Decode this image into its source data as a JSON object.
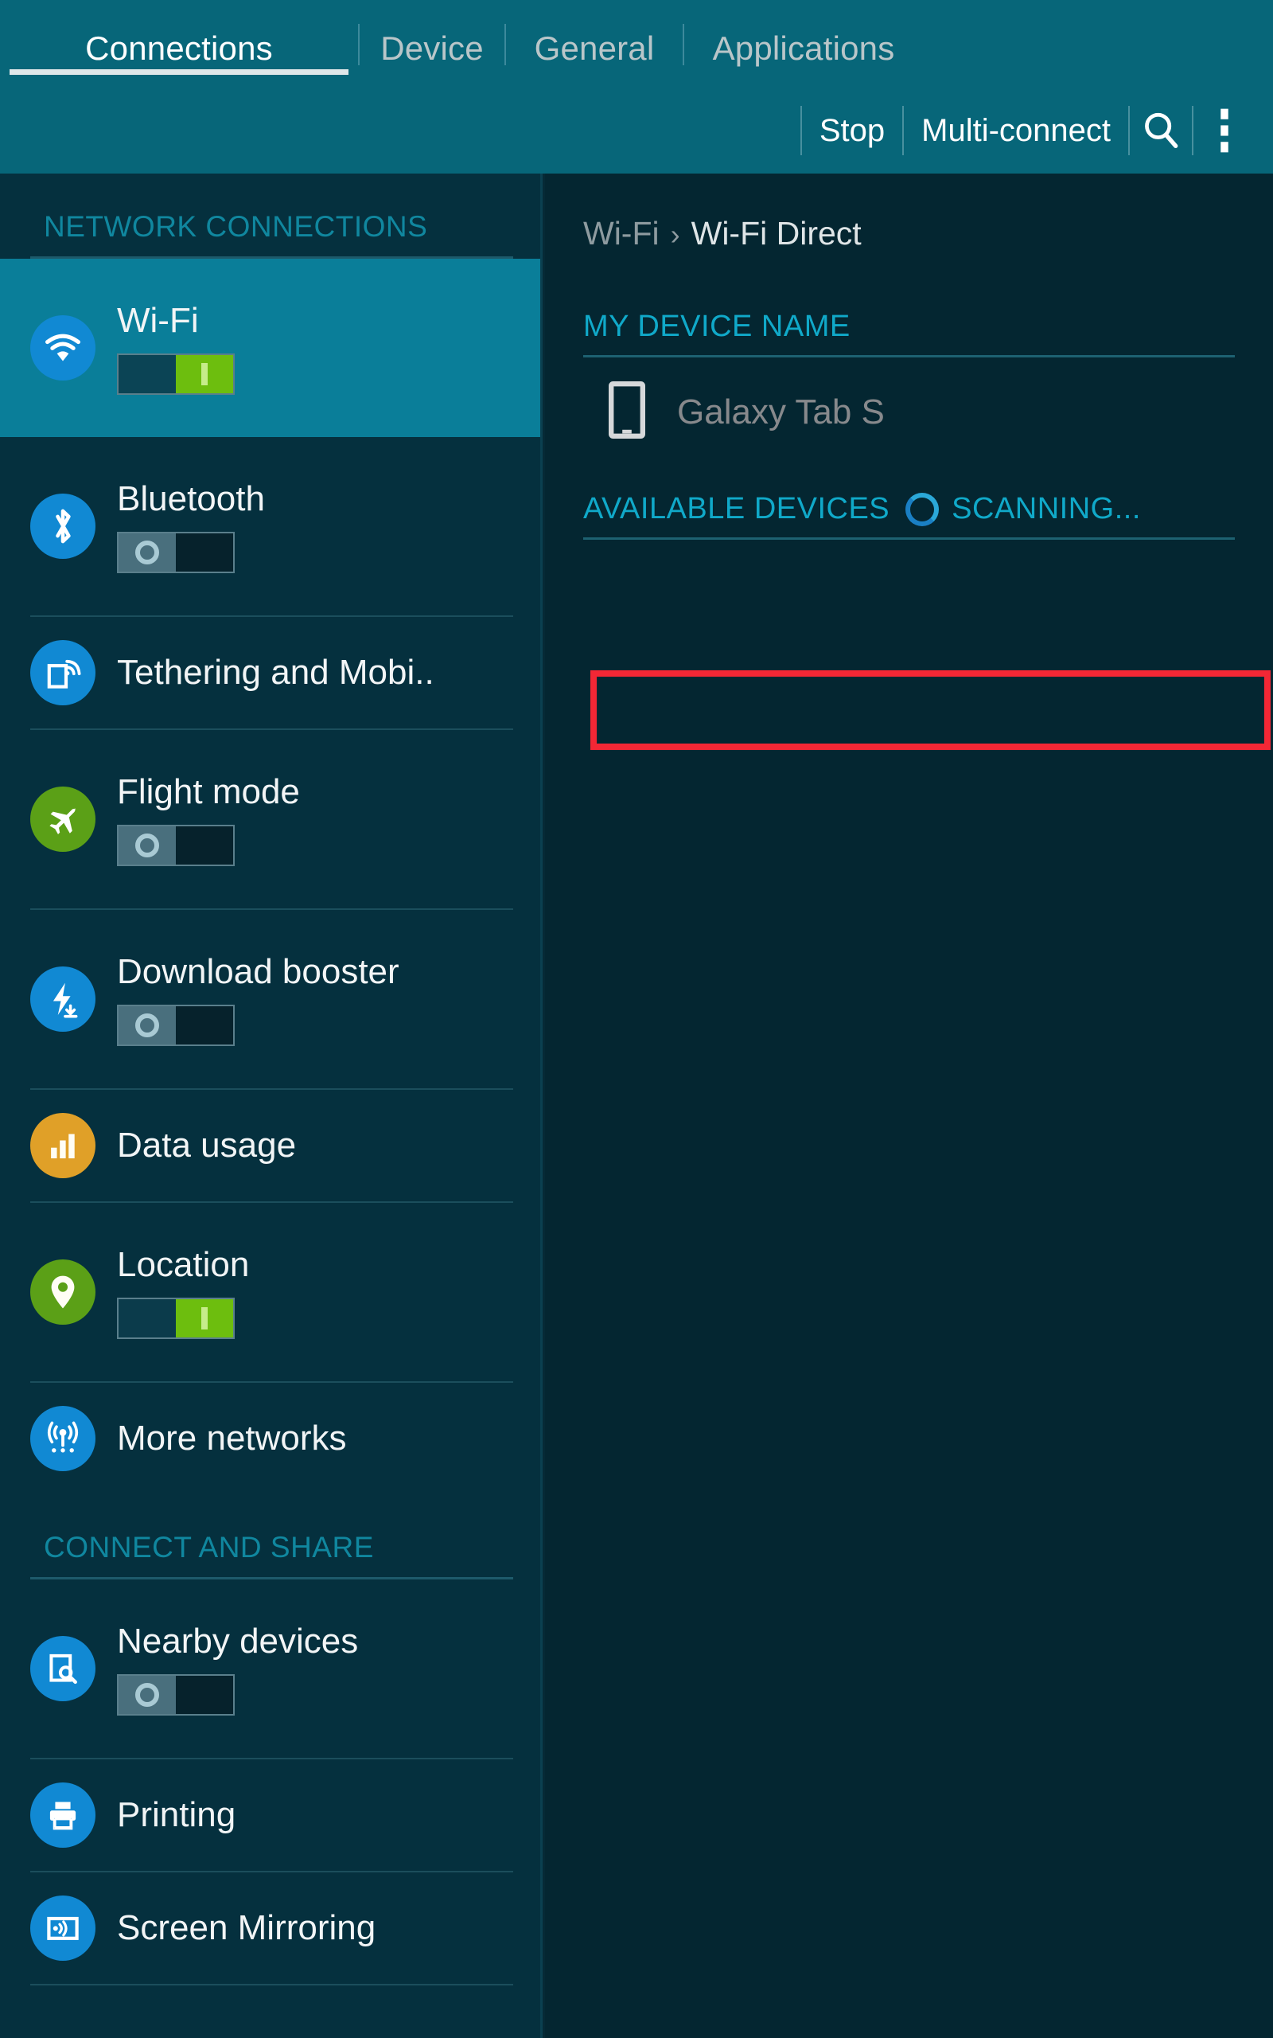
{
  "topbar": {
    "tabs": [
      {
        "label": "Connections",
        "active": true
      },
      {
        "label": "Device",
        "active": false
      },
      {
        "label": "General",
        "active": false
      },
      {
        "label": "Applications",
        "active": false
      }
    ],
    "actions": {
      "stop_label": "Stop",
      "multiconnect_label": "Multi-connect",
      "search_icon": "search-icon",
      "overflow_icon": "more-vertical-icon"
    }
  },
  "sidebar": {
    "sections": [
      {
        "title": "NETWORK CONNECTIONS",
        "items": [
          {
            "label": "Wi-Fi",
            "icon": "wifi-icon",
            "icon_color": "#1189d3",
            "selected": true,
            "toggle": "on"
          },
          {
            "label": "Bluetooth",
            "icon": "bluetooth-icon",
            "icon_color": "#1189d3",
            "selected": false,
            "toggle": "off"
          },
          {
            "label": "Tethering and Mobi..",
            "icon": "tethering-icon",
            "icon_color": "#1189d3",
            "selected": false,
            "toggle": "none"
          },
          {
            "label": "Flight mode",
            "icon": "airplane-icon",
            "icon_color": "#5ba017",
            "selected": false,
            "toggle": "off"
          },
          {
            "label": "Download booster",
            "icon": "download-boost-icon",
            "icon_color": "#1189d3",
            "selected": false,
            "toggle": "off"
          },
          {
            "label": "Data usage",
            "icon": "bar-chart-icon",
            "icon_color": "#e0a028",
            "selected": false,
            "toggle": "none"
          },
          {
            "label": "Location",
            "icon": "map-pin-icon",
            "icon_color": "#5ba017",
            "selected": false,
            "toggle": "on"
          },
          {
            "label": "More networks",
            "icon": "antenna-icon",
            "icon_color": "#1189d3",
            "selected": false,
            "toggle": "none"
          }
        ]
      },
      {
        "title": "CONNECT AND SHARE",
        "items": [
          {
            "label": "Nearby devices",
            "icon": "nearby-devices-icon",
            "icon_color": "#1189d3",
            "selected": false,
            "toggle": "off"
          },
          {
            "label": "Printing",
            "icon": "printer-icon",
            "icon_color": "#1189d3",
            "selected": false,
            "toggle": "none"
          },
          {
            "label": "Screen Mirroring",
            "icon": "screen-mirroring-icon",
            "icon_color": "#1189d3",
            "selected": false,
            "toggle": "none"
          }
        ]
      }
    ]
  },
  "main": {
    "breadcrumb": {
      "parent": "Wi-Fi",
      "separator": "›",
      "current": "Wi-Fi Direct"
    },
    "my_device": {
      "header": "MY DEVICE NAME",
      "device_name": "Galaxy Tab S",
      "device_icon": "smartphone-icon"
    },
    "available": {
      "header": "AVAILABLE DEVICES",
      "status": "SCANNING...",
      "spinner_icon": "loading-spinner-icon",
      "highlighted": true
    }
  },
  "colors": {
    "topbar_bg": "#076679",
    "sidebar_bg": "#05303e",
    "main_bg": "#042631",
    "selected_row": "#0a7e99",
    "section_header": "#10879f",
    "accent_teal": "#10a9c9",
    "toggle_on": "#6dbe0e",
    "highlight_red": "#f32735"
  }
}
